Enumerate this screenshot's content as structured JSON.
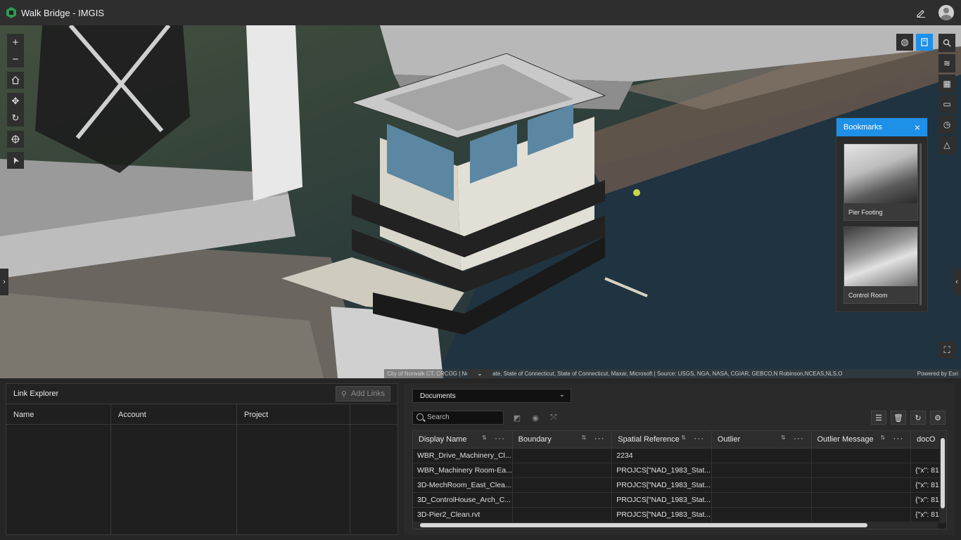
{
  "app": {
    "title": "Walk Bridge - IMGIS"
  },
  "map": {
    "attribution": "City of Norwalk CT, CRCOG | New York State, State of Connecticut, State of Connecticut, Maxar, Microsoft | Source: USGS, NGA, NASA, CGIAR, GEBCO,N Robinson,NCEAS,NLS,O",
    "powered_by": "Powered by Esri"
  },
  "bookmarks": {
    "title": "Bookmarks",
    "items": [
      {
        "label": "Pier Footing"
      },
      {
        "label": "Control Room"
      }
    ]
  },
  "link_explorer": {
    "title": "Link Explorer",
    "add_links_label": "Add Links",
    "columns": [
      "Name",
      "Account",
      "Project"
    ]
  },
  "documents": {
    "selected": "Documents",
    "search_placeholder": "Search",
    "columns": [
      "Display Name",
      "Boundary",
      "Spatial Reference",
      "Outlier",
      "Outlier Message",
      "docO"
    ],
    "rows": [
      {
        "display_name": "WBR_Drive_Machinery_Cl...",
        "boundary": "",
        "spatial_reference": "2234",
        "outlier": "",
        "outlier_message": "",
        "doc": ""
      },
      {
        "display_name": "WBR_Machinery Room-Ea...",
        "boundary": "",
        "spatial_reference": "PROJCS[\"NAD_1983_Stat...",
        "outlier": "",
        "outlier_message": "",
        "doc": "{\"x\": 81"
      },
      {
        "display_name": "3D-MechRoom_East_Clea...",
        "boundary": "",
        "spatial_reference": "PROJCS[\"NAD_1983_Stat...",
        "outlier": "",
        "outlier_message": "",
        "doc": "{\"x\": 81"
      },
      {
        "display_name": "3D_ControlHouse_Arch_C...",
        "boundary": "",
        "spatial_reference": "PROJCS[\"NAD_1983_Stat...",
        "outlier": "",
        "outlier_message": "",
        "doc": "{\"x\": 81"
      },
      {
        "display_name": "3D-Pier2_Clean.rvt",
        "boundary": "",
        "spatial_reference": "PROJCS[\"NAD_1983_Stat...",
        "outlier": "",
        "outlier_message": "",
        "doc": "{\"x\": 81"
      }
    ]
  }
}
